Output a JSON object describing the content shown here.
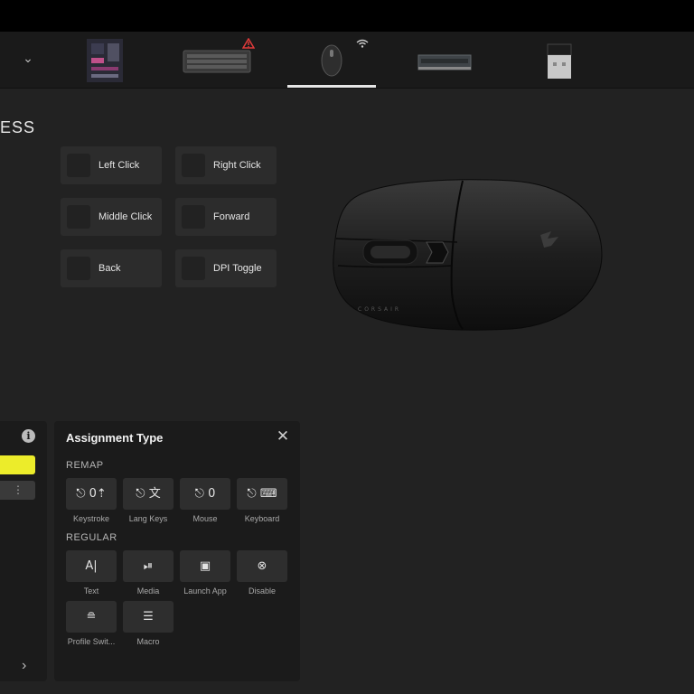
{
  "section": {
    "title": "ESS"
  },
  "devices": [
    {
      "name": "Motherboard",
      "icon": "motherboard-icon"
    },
    {
      "name": "Keyboard",
      "icon": "keyboard-icon",
      "status": "warning-icon"
    },
    {
      "name": "Mouse",
      "icon": "mouse-icon",
      "status": "wifi-icon",
      "active": true
    },
    {
      "name": "Memory",
      "icon": "ram-icon"
    },
    {
      "name": "Wireless Dongle",
      "icon": "usb-dongle-icon"
    }
  ],
  "keys": [
    {
      "label": "Left Click"
    },
    {
      "label": "Right Click"
    },
    {
      "label": "Middle Click"
    },
    {
      "label": "Forward"
    },
    {
      "label": "Back"
    },
    {
      "label": "DPI Toggle"
    }
  ],
  "assignment": {
    "title": "Assignment Type",
    "remap_label": "REMAP",
    "regular_label": "REGULAR",
    "remap": [
      {
        "label": "Keystroke",
        "glyph": "⎋ 0⇡",
        "icon": "keystroke-icon"
      },
      {
        "label": "Lang Keys",
        "glyph": "⎋ 文",
        "icon": "lang-keys-icon"
      },
      {
        "label": "Mouse",
        "glyph": "⎋ 0",
        "icon": "mouse-remap-icon"
      },
      {
        "label": "Keyboard",
        "glyph": "⎋ ⌨",
        "icon": "keyboard-remap-icon"
      }
    ],
    "regular": [
      {
        "label": "Text",
        "glyph": "A|",
        "icon": "text-icon"
      },
      {
        "label": "Media",
        "glyph": "⏯",
        "icon": "media-icon"
      },
      {
        "label": "Launch App",
        "glyph": "▣",
        "icon": "launch-app-icon"
      },
      {
        "label": "Disable",
        "glyph": "⊗",
        "icon": "disable-icon"
      },
      {
        "label": "Profile Swit...",
        "glyph": "≘",
        "icon": "profile-switch-icon"
      },
      {
        "label": "Macro",
        "glyph": "☰",
        "icon": "macro-icon"
      }
    ]
  },
  "colors": {
    "accent_yellow": "#ecec2a",
    "background": "#222222",
    "panel": "#1b1b1b",
    "warning": "#e23b3b"
  }
}
